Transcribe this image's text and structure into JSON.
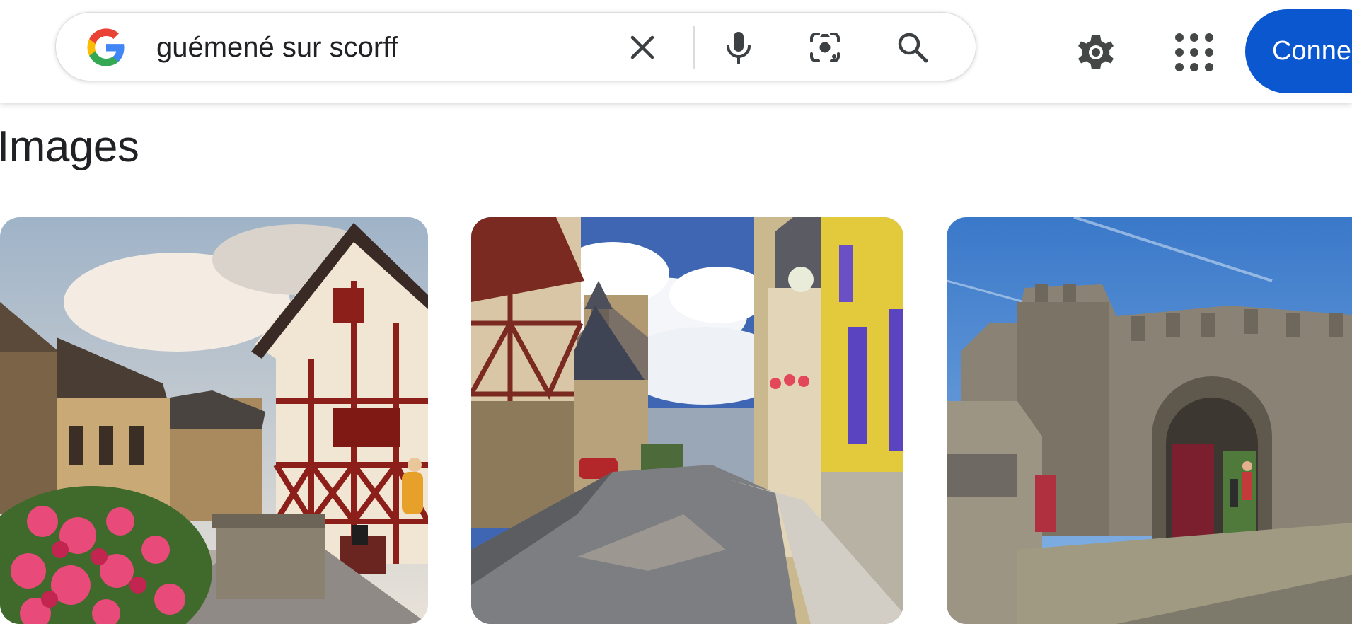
{
  "search": {
    "query": "guémené sur scorff"
  },
  "header": {
    "signin_label": "Connexion"
  },
  "images_section": {
    "title": "Images",
    "thumbnails": [
      {
        "description_icon": "half-timbered-house-street-thumbnail"
      },
      {
        "description_icon": "village-street-yellow-facade-thumbnail"
      },
      {
        "description_icon": "castle-gate-ruins-thumbnail"
      }
    ]
  },
  "colors": {
    "accent": "#0b57d0",
    "text": "#202124",
    "border": "#dadce0"
  }
}
